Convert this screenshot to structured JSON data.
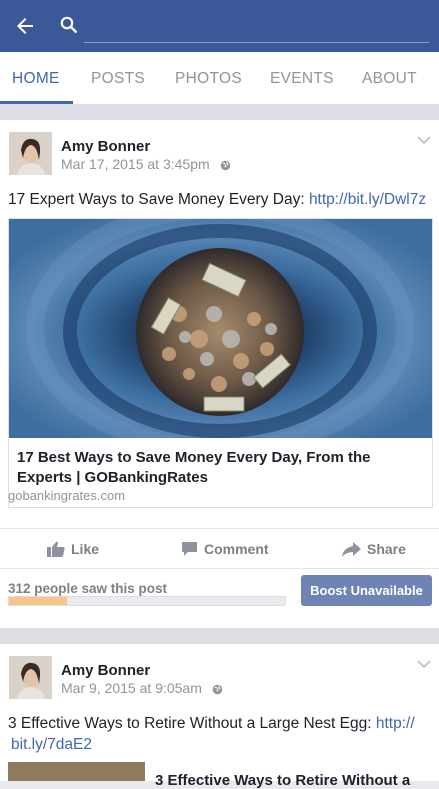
{
  "header": {
    "search_placeholder": "",
    "icons": [
      "back-arrow-icon",
      "search-icon"
    ],
    "color": "#3b5998"
  },
  "tabs": [
    {
      "label": "HOME",
      "active": true
    },
    {
      "label": "POSTS",
      "active": false
    },
    {
      "label": "PHOTOS",
      "active": false
    },
    {
      "label": "EVENTS",
      "active": false
    },
    {
      "label": "ABOUT",
      "active": false
    }
  ],
  "posts": [
    {
      "author": "Amy Bonner",
      "timestamp": "Mar 17, 2015 at 3:45pm",
      "text": "17 Expert Ways to Save Money Every Day: ",
      "link_text": "http://bit.ly/Dwl7z",
      "link_card": {
        "title": "17 Best Ways to Save Money Every Day, From the Experts | GOBankingRates",
        "domain": "gobankingrates.com"
      },
      "actions": {
        "like": "Like",
        "comment": "Comment",
        "share": "Share"
      },
      "reach_text": "312 people saw this post",
      "reach_progress": 0.21,
      "boost_label": "Boost Unavailable"
    },
    {
      "author": "Amy Bonner",
      "timestamp": "Mar 9, 2015 at 9:05am",
      "text": "3 Effective Ways to Retire Without a Large Nest Egg: ",
      "link_text_line1": "http://",
      "link_text_line2": "bit.ly/7daE2",
      "link_title_fragment": "3 Effective Ways to Retire Without a"
    }
  ],
  "colors": {
    "accent": "#4267b2",
    "boost": "#6d84b4",
    "progress": "#f7c58b"
  }
}
